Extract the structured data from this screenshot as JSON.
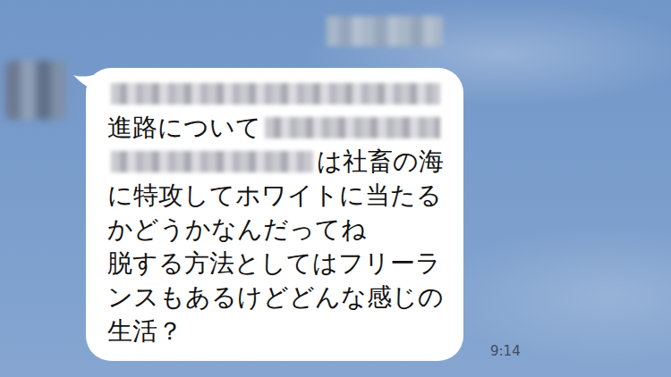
{
  "chat": {
    "title_blurred": true
  },
  "messages": [
    {
      "sender": "other",
      "avatar_blurred": true,
      "lines": [
        [
          {
            "kind": "blur"
          }
        ],
        [
          {
            "kind": "text",
            "text": "進路について"
          },
          {
            "kind": "blur"
          }
        ],
        [
          {
            "kind": "blur"
          },
          {
            "kind": "text",
            "text": "は社畜の海"
          }
        ],
        [
          {
            "kind": "text",
            "text": "に特攻してホワイトに当たる"
          }
        ],
        [
          {
            "kind": "text",
            "text": "かどうかなんだってね"
          }
        ],
        [
          {
            "kind": "text",
            "text": "脱する方法としてはフリーラ"
          }
        ],
        [
          {
            "kind": "text",
            "text": "ンスもあるけどどんな感じの"
          }
        ],
        [
          {
            "kind": "text",
            "text": "生活？"
          }
        ]
      ],
      "time": "9:14"
    }
  ]
}
